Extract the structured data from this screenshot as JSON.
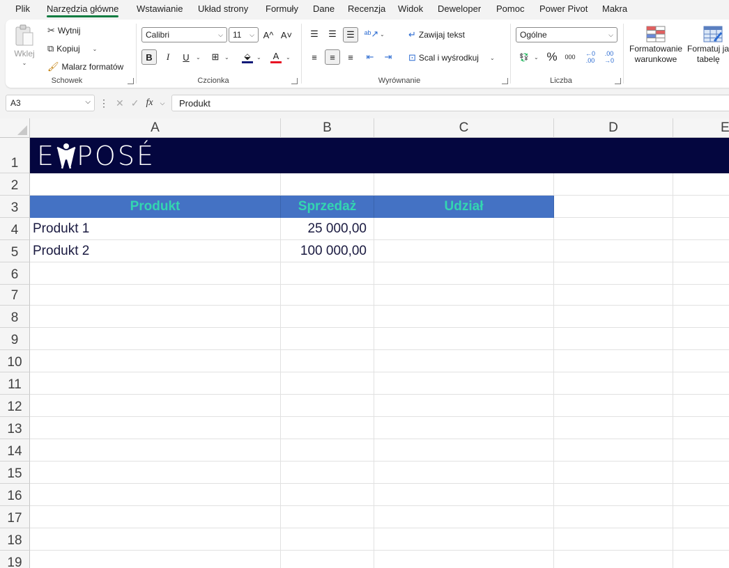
{
  "menu": {
    "tabs": [
      "Plik",
      "Narzędzia główne",
      "Wstawianie",
      "Układ strony",
      "Formuły",
      "Dane",
      "Recenzja",
      "Widok",
      "Deweloper",
      "Pomoc",
      "Power Pivot",
      "Makra"
    ],
    "active_index": 1
  },
  "ribbon": {
    "clipboard": {
      "paste": "Wklej",
      "cut": "Wytnij",
      "copy": "Kopiuj",
      "format_painter": "Malarz formatów",
      "group_label": "Schowek"
    },
    "font": {
      "family": "Calibri",
      "size": "11",
      "bold": "B",
      "italic": "I",
      "underline": "U",
      "grow": "A^",
      "shrink": "A˅",
      "font_color_letter": "A",
      "group_label": "Czcionka",
      "fill_color": "#0e1a78",
      "font_color": "#e81123"
    },
    "alignment": {
      "wrap_text": "Zawijaj tekst",
      "merge_center": "Scal i wyśrodkuj",
      "group_label": "Wyrównanie"
    },
    "number": {
      "format": "Ogólne",
      "percent": "%",
      "thousands": "000",
      "increase_decimal": "←0 .00",
      "decrease_decimal": ".00 →0",
      "group_label": "Liczba"
    },
    "styles": {
      "conditional_line1": "Formatowanie",
      "conditional_line2": "warunkowe",
      "table_line1": "Formatuj ja",
      "table_line2": "tabelę"
    }
  },
  "formula_bar": {
    "name_box": "A3",
    "fx": "fx",
    "content": "Produkt"
  },
  "sheet": {
    "columns": [
      "A",
      "B",
      "C",
      "D",
      "E"
    ],
    "rows": [
      "1",
      "2",
      "3",
      "4",
      "5",
      "6",
      "7",
      "8",
      "9",
      "10",
      "11",
      "12",
      "13",
      "14",
      "15",
      "16",
      "17",
      "18",
      "19"
    ],
    "logo_text": "EXPOSÉ",
    "header": {
      "product": "Produkt",
      "sales": "Sprzedaż",
      "share": "Udział"
    },
    "data": [
      {
        "product": "Produkt 1",
        "sales": "25 000,00"
      },
      {
        "product": "Produkt 2",
        "sales": "100 000,00"
      }
    ],
    "colors": {
      "banner": "#04063f",
      "header_fill": "#4472c4",
      "header_text": "#33d6b0"
    }
  }
}
